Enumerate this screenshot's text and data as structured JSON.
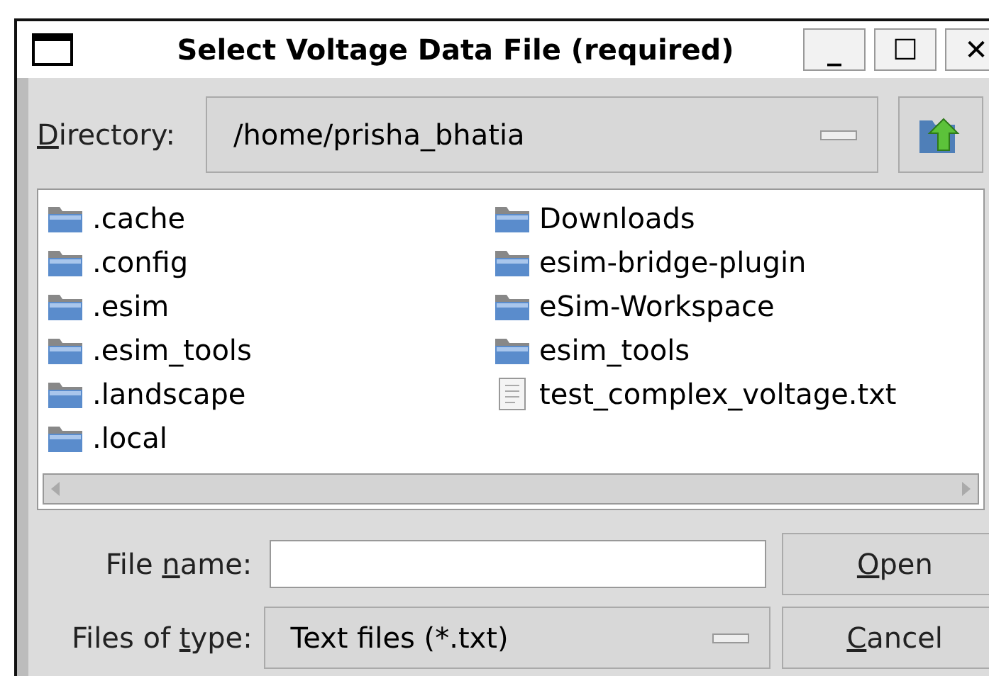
{
  "window": {
    "title": "Select Voltage Data File (required)",
    "controls": [
      "_",
      "☐",
      "✕"
    ]
  },
  "directory": {
    "label": {
      "key": "D",
      "after": "irectory:"
    },
    "value": "/home/prisha_bhatia"
  },
  "files": [
    {
      "name": ".cache",
      "kind": "folder"
    },
    {
      "name": ".config",
      "kind": "folder"
    },
    {
      "name": ".esim",
      "kind": "folder"
    },
    {
      "name": ".esim_tools",
      "kind": "folder"
    },
    {
      "name": ".landscape",
      "kind": "folder"
    },
    {
      "name": ".local",
      "kind": "folder"
    },
    {
      "name": "Downloads",
      "kind": "folder"
    },
    {
      "name": "esim-bridge-plugin",
      "kind": "folder"
    },
    {
      "name": "eSim-Workspace",
      "kind": "folder"
    },
    {
      "name": "esim_tools",
      "kind": "folder"
    },
    {
      "name": "test_complex_voltage.txt",
      "kind": "file"
    }
  ],
  "file_name": {
    "label": {
      "before": "File ",
      "key": "n",
      "after": "ame:"
    }
  },
  "file_type": {
    "label": {
      "before": "Files of ",
      "key": "t",
      "after": "ype:"
    },
    "value": "Text files (*.txt)"
  },
  "buttons": [
    {
      "key": "O",
      "after": "pen"
    },
    {
      "key": "C",
      "after": "ancel"
    }
  ]
}
